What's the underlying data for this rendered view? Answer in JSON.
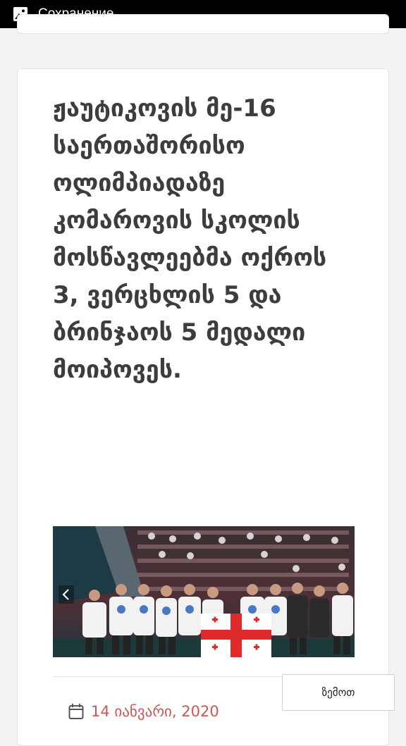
{
  "status_bar": {
    "icon": "image-icon",
    "title": "Сохранение..."
  },
  "article": {
    "headline": "ჟაუტიკოვის მე-16 საერთაშორისო ოლიმპიადაზე კომაროვის სკოლის მოსწავლეებმა ოქროს 3, ვერცხლის 5 და ბრინჯაოს 5 მედალი მოიპოვეს.",
    "photo_icon": "photo-students-with-georgian-flag",
    "date": "14 იანვარი, 2020",
    "date_icon": "calendar-icon",
    "date_color": "#d05555"
  },
  "scroll_top_button": {
    "label": "ზემოთ"
  }
}
